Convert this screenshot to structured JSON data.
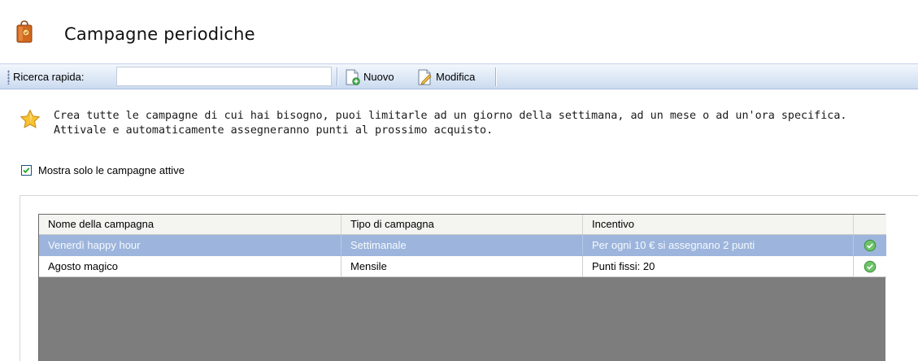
{
  "header": {
    "title": "Campagne periodiche",
    "icon": "shopping-bag-icon"
  },
  "toolbar": {
    "search_label": "Ricerca rapida:",
    "search_value": "",
    "new_label": "Nuovo",
    "new_icon": "new-document-icon",
    "edit_label": "Modifica",
    "edit_icon": "edit-document-icon"
  },
  "info": {
    "icon": "star-icon",
    "line1": "Crea tutte le campagne di cui hai bisogno, puoi limitarle ad un giorno della settimana, ad un mese o ad un'ora specifica.",
    "line2": "Attivale e automaticamente assegneranno punti al prossimo acquisto."
  },
  "filter": {
    "label": "Mostra solo le campagne attive",
    "checked": true
  },
  "table": {
    "columns": [
      "Nome della campagna",
      "Tipo di campagna",
      "Incentivo",
      ""
    ],
    "rows": [
      {
        "name": "Venerdì happy hour",
        "type": "Settimanale",
        "incentive": "Per ogni 10 € si assegnano 2 punti",
        "status_icon": "check-circle-icon",
        "selected": true
      },
      {
        "name": "Agosto magico",
        "type": "Mensile",
        "incentive": "Punti fissi: 20",
        "status_icon": "check-circle-icon",
        "selected": false
      }
    ]
  },
  "colors": {
    "toolbar": "#dde8f6",
    "selected_row": "#9db5dc",
    "grid_empty": "#7d7d7d",
    "status_ok": "#5cb85c"
  }
}
